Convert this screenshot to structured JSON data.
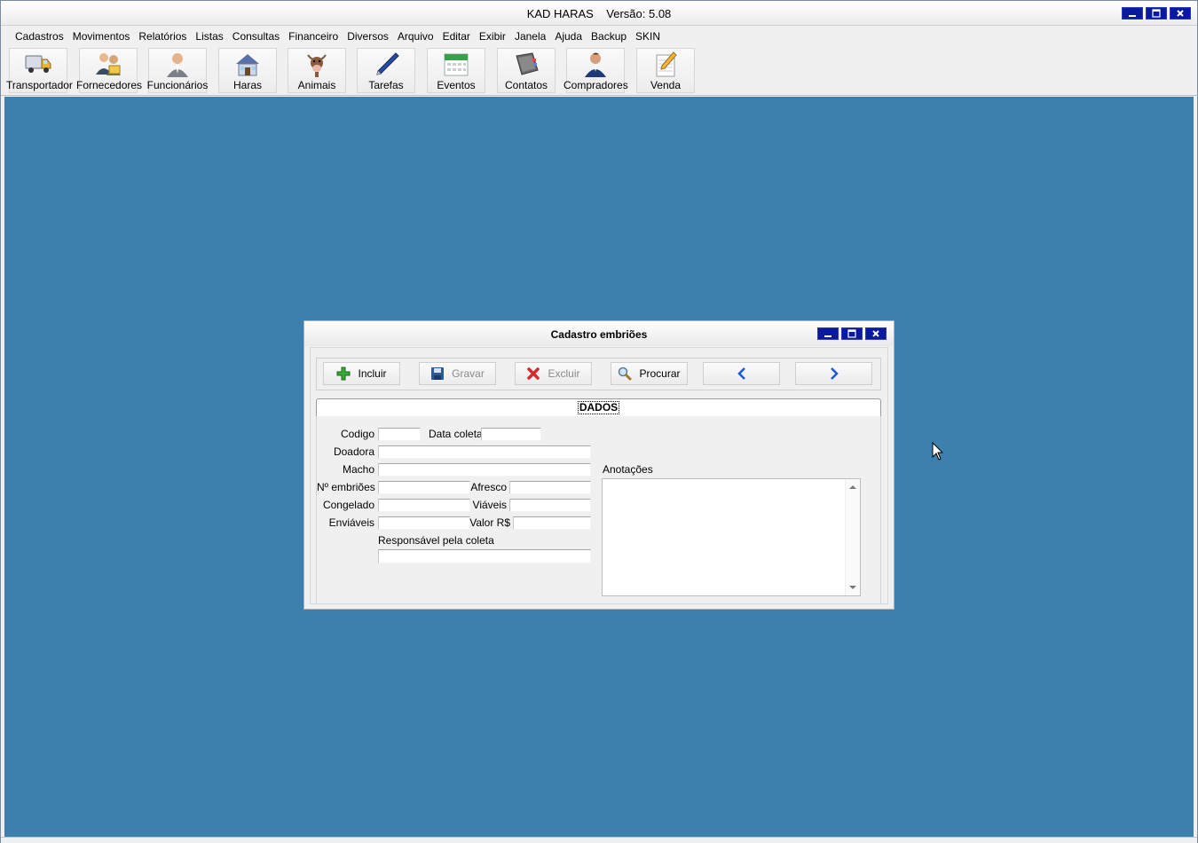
{
  "app": {
    "title": "KAD HARAS    Versão: 5.08"
  },
  "menu": [
    "Cadastros",
    "Movimentos",
    "Relatórios",
    "Listas",
    "Consultas",
    "Financeiro",
    "Diversos",
    "Arquivo",
    "Editar",
    "Exibir",
    "Janela",
    "Ajuda",
    "Backup",
    "SKIN"
  ],
  "toolbar": [
    {
      "label": "Transportador",
      "icon": "truck-icon"
    },
    {
      "label": "Fornecedores",
      "icon": "suppliers-icon"
    },
    {
      "label": "Funcionários",
      "icon": "employee-icon"
    },
    {
      "label": "Haras",
      "icon": "house-icon"
    },
    {
      "label": "Animais",
      "icon": "cow-icon"
    },
    {
      "label": "Tarefas",
      "icon": "pen-icon"
    },
    {
      "label": "Eventos",
      "icon": "calendar-icon"
    },
    {
      "label": "Contatos",
      "icon": "address-book-icon"
    },
    {
      "label": "Compradores",
      "icon": "buyer-icon"
    },
    {
      "label": "Venda",
      "icon": "notepad-pencil-icon"
    }
  ],
  "dialog": {
    "title": "Cadastro embriões",
    "actions": {
      "incluir": "Incluir",
      "gravar": "Gravar",
      "excluir": "Excluir",
      "procurar": "Procurar"
    },
    "tab": "DADOS",
    "labels": {
      "codigo": "Codigo",
      "data_coleta": "Data coleta",
      "doadora": "Doadora",
      "macho": "Macho",
      "n_embrioes": "Nº embriões",
      "afresco": "Afresco",
      "congelado": "Congelado",
      "viaveis": "Viáveis",
      "enviaveis": "Enviáveis",
      "valor": "Valor R$",
      "responsavel": "Responsável pela coleta",
      "anotacoes": "Anotações"
    },
    "values": {
      "codigo": "",
      "data_coleta": "",
      "doadora": "",
      "macho": "",
      "n_embrioes": "",
      "afresco": "",
      "congelado": "",
      "viaveis": "",
      "enviaveis": "",
      "valor": "",
      "responsavel": "",
      "anotacoes": ""
    }
  },
  "colors": {
    "workspace": "#3d80ad",
    "window_buttons": "#0a1a9c"
  }
}
